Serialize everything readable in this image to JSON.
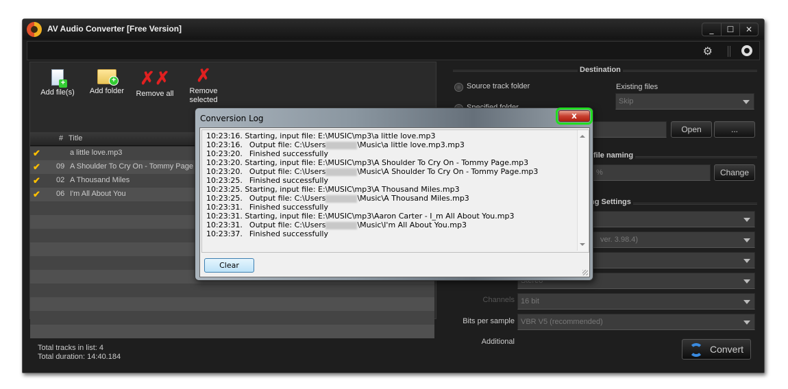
{
  "window": {
    "title": "AV Audio Converter [Free Version]",
    "controls": {
      "minimize": "_",
      "maximize": "☐",
      "close": "✕"
    }
  },
  "topbar": {
    "settings_icon": "gear-icon",
    "power_icon": "power-icon"
  },
  "toolbar": {
    "add_files": "Add file(s)",
    "add_folder": "Add folder",
    "remove_all": "Remove all",
    "remove_selected_1": "Remove",
    "remove_selected_2": "selected"
  },
  "tracklist": {
    "headers": {
      "num": "#",
      "title": "Title"
    },
    "rows": [
      {
        "checked": "✔",
        "num": "",
        "title": "a little love.mp3"
      },
      {
        "checked": "✔",
        "num": "09",
        "title": "A Shoulder To Cry On - Tommy Page"
      },
      {
        "checked": "✔",
        "num": "02",
        "title": "A Thousand Miles"
      },
      {
        "checked": "✔",
        "num": "06",
        "title": "I'm All About You"
      }
    ]
  },
  "footer": {
    "total_tracks": "Total tracks in list: 4",
    "total_duration": "Total duration: 14:40.184"
  },
  "destination": {
    "title": "Destination",
    "source_track_folder": "Source track folder",
    "specified_folder": "Specified folder",
    "existing_files_label": "Existing files",
    "existing_files_value": "Skip",
    "open_button": "Open",
    "browse_button": "..."
  },
  "file_naming": {
    "title": "file naming",
    "pattern_value": "%",
    "change_button": "Change"
  },
  "encoding": {
    "title": "ng Settings",
    "encoder_value": "ver. 3.98.4)",
    "channels_label": "Channels",
    "channels_value": "Stereo",
    "bits_label": "Bits per sample",
    "bits_value": "16 bit",
    "additional_label": "Additional",
    "additional_value": "VBR V5 (recommended)"
  },
  "convert_button": "Convert",
  "dialog": {
    "title": "Conversion Log",
    "close": "x",
    "clear_button": "Clear",
    "log": [
      {
        "time": "10:23:16.",
        "text": " Starting, input file: E:\\MUSIC\\mp3\\a little love.mp3",
        "indent": false
      },
      {
        "time": "10:23:16.",
        "pre": "Output file: C:\\Users",
        "post": "\\Music\\a little love.mp3.mp3",
        "indent": true
      },
      {
        "time": "10:23:20.",
        "text": "Finished successfully",
        "indent": true
      },
      {
        "time": "10:23:20.",
        "text": " Starting, input file: E:\\MUSIC\\mp3\\A Shoulder To Cry On - Tommy Page.mp3",
        "indent": false
      },
      {
        "time": "10:23:20.",
        "pre": "Output file: C:\\Users",
        "post": "\\Music\\A Shoulder To Cry On - Tommy Page.mp3",
        "indent": true
      },
      {
        "time": "10:23:25.",
        "text": "Finished successfully",
        "indent": true
      },
      {
        "time": "10:23:25.",
        "text": " Starting, input file: E:\\MUSIC\\mp3\\A Thousand Miles.mp3",
        "indent": false
      },
      {
        "time": "10:23:25.",
        "pre": "Output file: C:\\Users",
        "post": "\\Music\\A Thousand Miles.mp3",
        "indent": true
      },
      {
        "time": "10:23:31.",
        "text": "Finished successfully",
        "indent": true
      },
      {
        "time": "10:23:31.",
        "text": " Starting, input file: E:\\MUSIC\\mp3\\Aaron Carter - I_m All About You.mp3",
        "indent": false
      },
      {
        "time": "10:23:31.",
        "pre": "Output file: C:\\Users",
        "post": "\\Music\\I'm All About You.mp3",
        "indent": true
      },
      {
        "time": "10:23:37.",
        "text": "Finished successfully",
        "indent": true
      }
    ]
  }
}
